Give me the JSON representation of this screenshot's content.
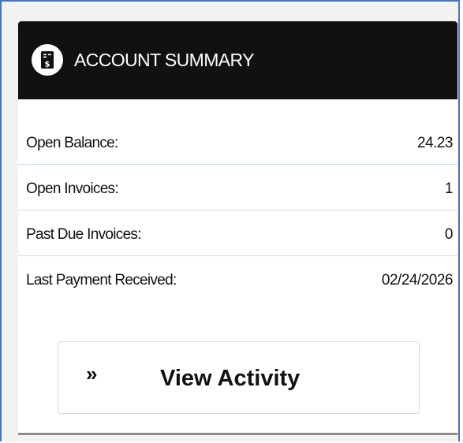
{
  "header": {
    "icon": "invoice-dollar-icon",
    "title": "ACCOUNT SUMMARY"
  },
  "rows": [
    {
      "label": "Open Balance:",
      "value": "24.23"
    },
    {
      "label": "Open Invoices:",
      "value": "1"
    },
    {
      "label": "Past Due Invoices:",
      "value": "0"
    },
    {
      "label": "Last Payment Received:",
      "value": "02/24/2026"
    }
  ],
  "action": {
    "icon": "double-chevron-right-icon",
    "chevron": "»",
    "label": "View Activity"
  },
  "colors": {
    "header_bg": "#111111",
    "divider": "#c9dcec",
    "frame_border": "#4a74b8"
  }
}
